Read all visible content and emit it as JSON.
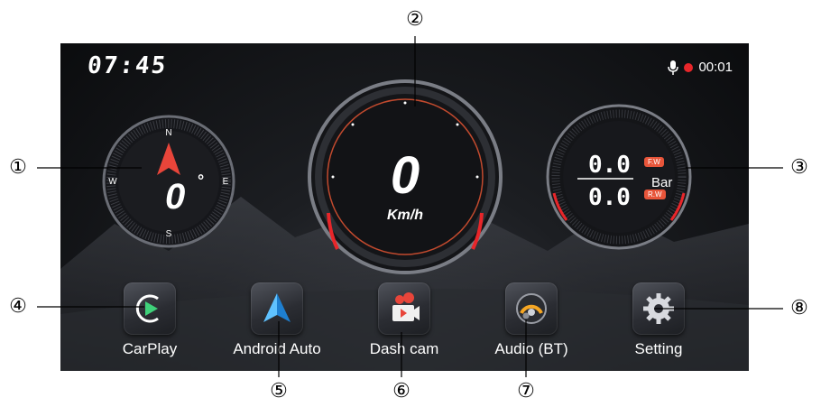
{
  "status_bar": {
    "clock": "07:45",
    "recording_time": "00:01"
  },
  "compass": {
    "heading_value": "0",
    "degree_symbol": "°",
    "north": "N",
    "south": "S",
    "east": "E",
    "west": "W"
  },
  "speedometer": {
    "speed_value": "0",
    "unit": "Km/h"
  },
  "tire_pressure": {
    "front_value": "0.0",
    "front_label": "F.W",
    "rear_value": "0.0",
    "rear_label": "R.W",
    "unit": "Bar"
  },
  "apps": [
    {
      "label": "CarPlay"
    },
    {
      "label": "Android Auto"
    },
    {
      "label": "Dash cam"
    },
    {
      "label": "Audio (BT)"
    },
    {
      "label": "Setting"
    }
  ],
  "callouts": [
    "①",
    "②",
    "③",
    "④",
    "⑤",
    "⑥",
    "⑦",
    "⑧"
  ],
  "colors": {
    "accent_red": "#e8262a",
    "badge_orange": "#e8553a",
    "carplay_green": "#3fd17a",
    "android_blue": "#2aa3f0"
  }
}
